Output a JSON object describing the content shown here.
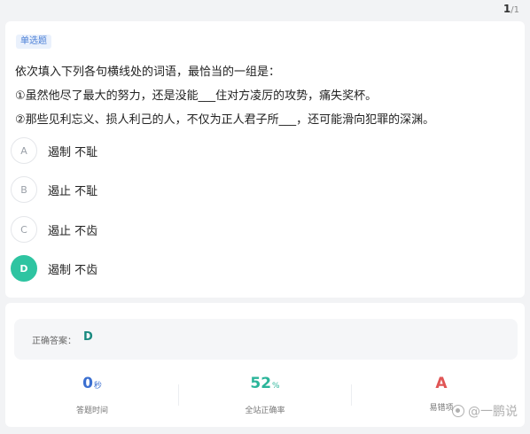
{
  "header": {
    "page_current": "1",
    "page_total": "/1"
  },
  "question": {
    "type_badge": "单选题",
    "stem_lines": [
      "依次填入下列各句横线处的词语，最恰当的一组是：",
      "①虽然他尽了最大的努力，还是没能___住对方凌厉的攻势，痛失奖杯。",
      "②那些见利忘义、损人利己的人，不仅为正人君子所___，还可能滑向犯罪的深渊。"
    ],
    "options": [
      {
        "letter": "A",
        "text": "遏制  不耻",
        "selected": false
      },
      {
        "letter": "B",
        "text": "遏止  不耻",
        "selected": false
      },
      {
        "letter": "C",
        "text": "遏止  不齿",
        "selected": false
      },
      {
        "letter": "D",
        "text": "遏制  不齿",
        "selected": true
      }
    ]
  },
  "result": {
    "answer_label": "正确答案：",
    "answer_value": "D",
    "stats": {
      "time_value": "0",
      "time_unit": "秒",
      "time_label": "答题时间",
      "rate_value": "52",
      "rate_unit": "%",
      "rate_label": "全站正确率",
      "err_value": "A",
      "err_label": "易错项"
    }
  },
  "watermark": "@一鹏说",
  "colors": {
    "selected_option": "#2ec4a1",
    "badge_text": "#4a7fd6",
    "time_value": "#3b6fd0",
    "rate_value": "#2bb59a",
    "err_value": "#e05555"
  }
}
